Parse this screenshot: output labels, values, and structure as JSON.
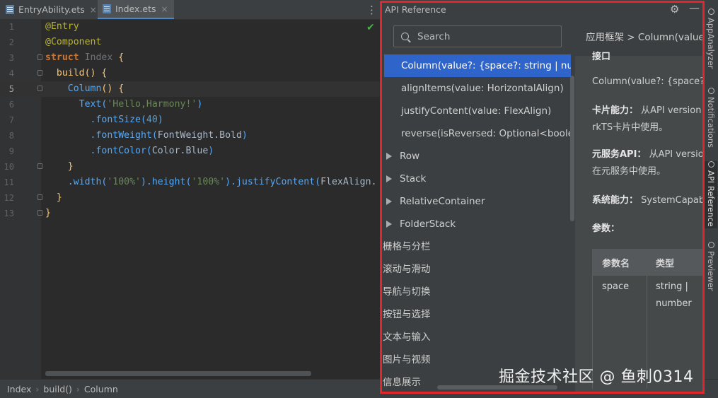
{
  "editor": {
    "tabs": [
      {
        "label": "EntryAbility.ets",
        "close": "×"
      },
      {
        "label": "Index.ets",
        "close": "×"
      }
    ],
    "menu_glyph": "⋮",
    "check_glyph": "✔",
    "lines": [
      {
        "n": "1",
        "parts": [
          {
            "t": "@Entry",
            "c": "k-dec"
          }
        ]
      },
      {
        "n": "2",
        "parts": [
          {
            "t": "@Component",
            "c": "k-dec"
          }
        ]
      },
      {
        "n": "3",
        "parts": [
          {
            "t": "struct ",
            "c": "k-kw"
          },
          {
            "t": "Index",
            "c": "k-cls"
          },
          {
            "t": " {",
            "c": "k-fn"
          }
        ]
      },
      {
        "n": "4",
        "parts": [
          {
            "t": "  build",
            "c": "k-fn"
          },
          {
            "t": "() {",
            "c": "k-fn"
          }
        ]
      },
      {
        "n": "5",
        "parts": [
          {
            "t": "    Column",
            "c": "k-comp"
          },
          {
            "t": "() {",
            "c": "k-fn"
          }
        ]
      },
      {
        "n": "6",
        "parts": [
          {
            "t": "      Text(",
            "c": "k-comp"
          },
          {
            "t": "'Hello,Harmony!'",
            "c": "k-str"
          },
          {
            "t": ")",
            "c": "k-comp"
          }
        ]
      },
      {
        "n": "7",
        "parts": [
          {
            "t": "        .fontSize(",
            "c": "k-comp"
          },
          {
            "t": "40",
            "c": "k-num"
          },
          {
            "t": ")",
            "c": "k-comp"
          }
        ]
      },
      {
        "n": "8",
        "parts": [
          {
            "t": "        .fontWeight(",
            "c": "k-comp"
          },
          {
            "t": "FontWeight.Bold",
            "c": ""
          },
          {
            "t": ")",
            "c": "k-comp"
          }
        ]
      },
      {
        "n": "9",
        "parts": [
          {
            "t": "        .fontColor(",
            "c": "k-comp"
          },
          {
            "t": "Color.Blue",
            "c": ""
          },
          {
            "t": ")",
            "c": "k-comp"
          }
        ]
      },
      {
        "n": "10",
        "parts": [
          {
            "t": "    }",
            "c": "k-fn"
          }
        ]
      },
      {
        "n": "11",
        "parts": [
          {
            "t": "    .width(",
            "c": "k-comp"
          },
          {
            "t": "'100%'",
            "c": "k-str"
          },
          {
            "t": ").height(",
            "c": "k-comp"
          },
          {
            "t": "'100%'",
            "c": "k-str"
          },
          {
            "t": ").justifyContent(",
            "c": "k-comp"
          },
          {
            "t": "FlexAlign.",
            "c": ""
          }
        ]
      },
      {
        "n": "12",
        "parts": [
          {
            "t": "  }",
            "c": "k-fn"
          }
        ]
      },
      {
        "n": "13",
        "parts": [
          {
            "t": "}",
            "c": "k-fn"
          }
        ]
      }
    ],
    "current_line": "5"
  },
  "status_bar": {
    "crumbs": [
      "Index",
      "build()",
      "Column"
    ]
  },
  "api_reference": {
    "title": "API Reference",
    "search_placeholder": "Search",
    "tree": [
      {
        "label": "Column(value?: {space?: string | number",
        "selected": true,
        "expandable": false,
        "indent": "method"
      },
      {
        "label": "alignItems(value: HorizontalAlign)",
        "selected": false,
        "expandable": false,
        "indent": "method"
      },
      {
        "label": "justifyContent(value: FlexAlign)",
        "selected": false,
        "expandable": false,
        "indent": "method"
      },
      {
        "label": "reverse(isReversed: Optional<boolean>",
        "selected": false,
        "expandable": false,
        "indent": "method"
      },
      {
        "label": "Row",
        "selected": false,
        "expandable": true,
        "indent": "node"
      },
      {
        "label": "Stack",
        "selected": false,
        "expandable": true,
        "indent": "node"
      },
      {
        "label": "RelativeContainer",
        "selected": false,
        "expandable": true,
        "indent": "node"
      },
      {
        "label": "FolderStack",
        "selected": false,
        "expandable": true,
        "indent": "node"
      },
      {
        "label": "栅格与分栏",
        "selected": false,
        "expandable": false,
        "indent": "category"
      },
      {
        "label": "滚动与滑动",
        "selected": false,
        "expandable": false,
        "indent": "category"
      },
      {
        "label": "导航与切换",
        "selected": false,
        "expandable": false,
        "indent": "category"
      },
      {
        "label": "按钮与选择",
        "selected": false,
        "expandable": false,
        "indent": "category"
      },
      {
        "label": "文本与输入",
        "selected": false,
        "expandable": false,
        "indent": "category"
      },
      {
        "label": "图片与视频",
        "selected": false,
        "expandable": false,
        "indent": "category"
      },
      {
        "label": "信息展示",
        "selected": false,
        "expandable": false,
        "indent": "category"
      }
    ],
    "doc": {
      "breadcrumb": "应用框架 > Column(value?:",
      "section": "接口",
      "signature": "Column(value?: {space?: s",
      "card_label": "卡片能力：",
      "card_text1": "从API version",
      "card_text2": "rkTS卡片中使用。",
      "meta_label": "元服务API：",
      "meta_text1": "从API versio",
      "meta_text2": "在元服务中使用。",
      "syscap_label": "系统能力：",
      "syscap_text": "SystemCapab",
      "params_label": "参数：",
      "table": {
        "headers": [
          "参数名",
          "类型"
        ],
        "row": [
          "space",
          "string |",
          "number"
        ]
      }
    }
  },
  "tool_strip": [
    "AppAnalyzer",
    "Notifications",
    "API Reference",
    "Previewer"
  ],
  "watermark": "掘金技术社区 @ 鱼刺0314",
  "colors": {
    "accent": "#2f65ca",
    "highlight_frame": "#e2262a"
  }
}
